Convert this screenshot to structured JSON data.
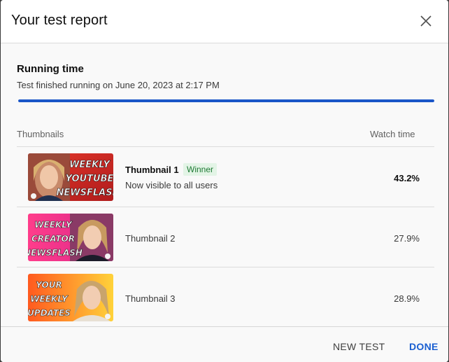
{
  "dialog": {
    "title": "Your test report",
    "close_icon": "close-icon"
  },
  "running": {
    "title": "Running time",
    "subtitle": "Test finished running on June 20, 2023 at 2:17 PM",
    "progress_percent": 100
  },
  "table": {
    "headers": {
      "thumbnails": "Thumbnails",
      "watch_time": "Watch time"
    },
    "rows": [
      {
        "name": "Thumbnail 1",
        "badge": "Winner",
        "status": "Now visible to all users",
        "value": "43.2%",
        "thumb_lines": [
          "WEEKLY",
          "YOUTUBE",
          "NEWSFLASH"
        ]
      },
      {
        "name": "Thumbnail 2",
        "value": "27.9%",
        "thumb_lines": [
          "WEEKLY",
          "CREATOR",
          "NEWSFLASH"
        ]
      },
      {
        "name": "Thumbnail 3",
        "value": "28.9%",
        "thumb_lines": [
          "YOUR",
          "WEEKLY",
          "UPDATES"
        ]
      }
    ]
  },
  "footer": {
    "new_test": "NEW TEST",
    "done": "DONE"
  },
  "colors": {
    "accent": "#1a56c8",
    "winner_bg": "#e3f4e6",
    "winner_text": "#1e7a34"
  }
}
